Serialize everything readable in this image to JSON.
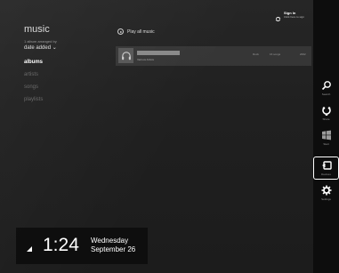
{
  "app": {
    "title": "music"
  },
  "sort": {
    "caption": "1 album arranged by",
    "value": "date added ⌄"
  },
  "nav": {
    "items": [
      {
        "label": "albums",
        "active": true
      },
      {
        "label": "artists",
        "active": false
      },
      {
        "label": "songs",
        "active": false
      },
      {
        "label": "playlists",
        "active": false
      }
    ]
  },
  "main": {
    "play_all_label": "Play all music",
    "album": {
      "artist": "Various Artists",
      "genre": "Rock",
      "count": "16 songs",
      "year": "2002"
    }
  },
  "account": {
    "label": "Sign In",
    "sub": "Click here to sign"
  },
  "charms": [
    {
      "label": "Search",
      "icon": "search-icon"
    },
    {
      "label": "Share",
      "icon": "share-icon"
    },
    {
      "label": "Start",
      "icon": "windows-icon"
    },
    {
      "label": "Devices",
      "icon": "devices-icon",
      "selected": true
    },
    {
      "label": "Settings",
      "icon": "gear-icon"
    }
  ],
  "clock": {
    "time": "1:24",
    "day": "Wednesday",
    "date": "September 26"
  }
}
